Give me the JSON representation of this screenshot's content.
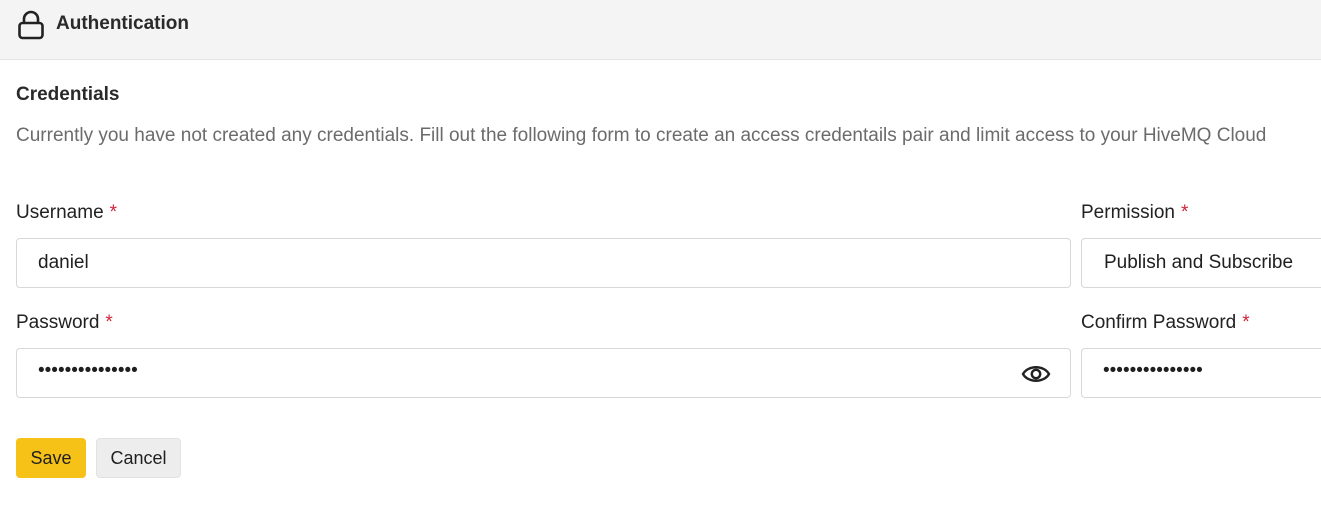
{
  "header": {
    "title": "Authentication",
    "icon": "lock-icon"
  },
  "credentials": {
    "title": "Credentials",
    "description": "Currently you have not created any credentials. Fill out the following form to create an access credentails pair and limit access to your HiveMQ Cloud"
  },
  "form": {
    "username": {
      "label": "Username",
      "required_mark": "*",
      "value": "daniel"
    },
    "permission": {
      "label": "Permission",
      "required_mark": "*",
      "value": "Publish and Subscribe"
    },
    "password": {
      "label": "Password",
      "required_mark": "*",
      "value": "•••••••••••••••",
      "toggle_icon": "eye-icon"
    },
    "confirm_password": {
      "label": "Confirm Password",
      "required_mark": "*",
      "value": "•••••••••••••••"
    }
  },
  "actions": {
    "save_label": "Save",
    "cancel_label": "Cancel"
  },
  "colors": {
    "accent": "#f6c217",
    "required": "#d0243b",
    "header_bg": "#f4f4f4",
    "muted_text": "#6b6b6b"
  }
}
